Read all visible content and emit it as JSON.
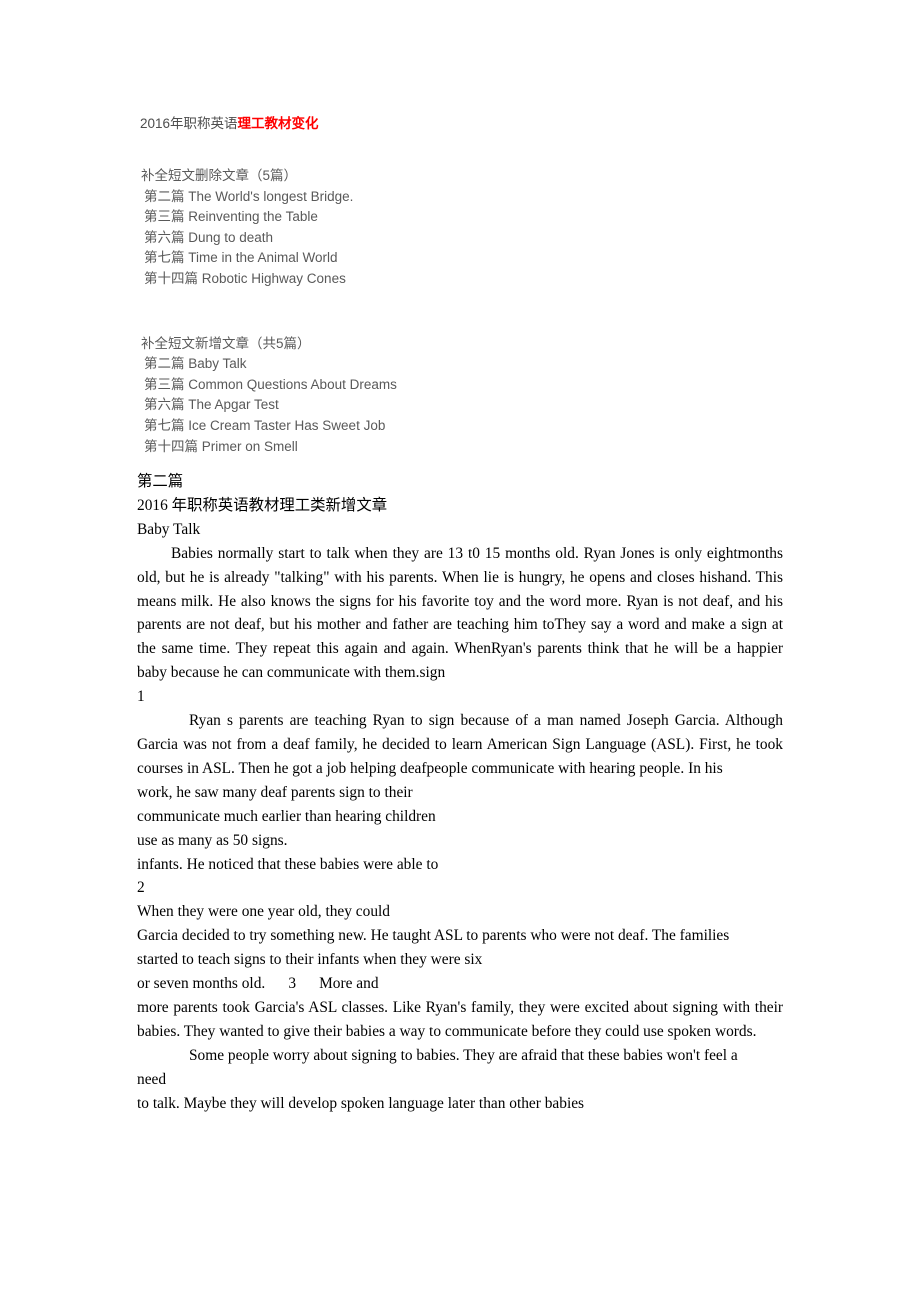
{
  "document": {
    "notes": {
      "title_prefix": "2016年职称英语",
      "title_accent": "理工教材变化",
      "removed_section": {
        "heading": "补全短文删除文章（5篇）",
        "items": [
          "第二篇 The World's longest Bridge.",
          "第三篇 Reinventing the Table",
          "第六篇 Dung to death",
          "第七篇 Time in the Animal World",
          "第十四篇 Robotic Highway Cones"
        ]
      },
      "added_section": {
        "heading": "补全短文新增文章（共5篇）",
        "items": [
          "第二篇 Baby Talk",
          "第三篇 Common Questions About Dreams",
          "第六篇 The Apgar Test",
          "第七篇 Ice Cream Taster Has Sweet Job",
          "第十四篇 Primer on Smell"
        ]
      }
    },
    "article": {
      "section_label": "第二篇",
      "subtitle": "2016 年职称英语教材理工类新增文章",
      "title": "Baby Talk",
      "paragraph_1": "Babies normally start to talk when they are 13 t0 15 months old. Ryan Jones is only eightmonths old, but he is already \"talking\" with his parents. When lie is hungry, he opens and closes hishand. This means milk. He also knows the signs for his favorite toy and the word more. Ryan is not deaf, and his parents are not deaf, but his mother and father are teaching him toThey say a word and make a sign at the same time. They repeat this again and again. WhenRyan's parents think that he will be a happier baby because he can communicate with them.sign",
      "marker_1": "1",
      "paragraph_2": "Ryan s parents are teaching Ryan to sign because of a man named Joseph Garcia. Although Garcia was not from a deaf family, he decided to learn American Sign Language (ASL). First, he took courses in ASL. Then he got a job helping deafpeople communicate with hearing people. In his",
      "fragment_lines_a": [
        "work, he saw many deaf parents sign to their",
        "communicate much earlier than hearing children",
        "use as many as 50 signs.",
        "infants. He noticed that these babies were able to"
      ],
      "marker_2": "2",
      "fragment_lines_b": [
        "When they were one year old, they could",
        "Garcia decided to try something new. He taught ASL to parents who were not deaf. The families",
        "started to teach signs to their infants when they were six"
      ],
      "marker_3_line": "or seven months old.      3      More and",
      "paragraph_3": "more parents took Garcia's ASL classes. Like Ryan's family, they were excited about signing with their babies. They wanted to give their babies a way to communicate before they could use spoken words.",
      "paragraph_4": "Some people worry about signing to babies. They are afraid that these babies won't feel a",
      "fragment_need": "need",
      "fragment_last": "to talk. Maybe they will develop spoken language later than other babies"
    }
  },
  "colors": {
    "accent_red": "#ff0000",
    "note_gray": "#595959",
    "body_black": "#000000"
  }
}
